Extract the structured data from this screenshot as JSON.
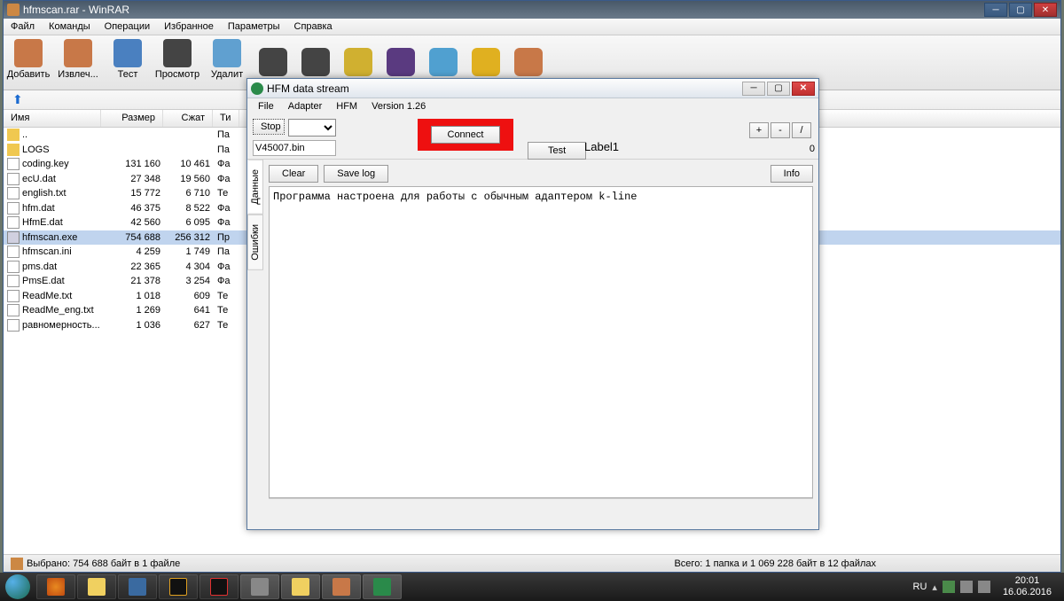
{
  "winrar": {
    "title": "hfmscan.rar - WinRAR",
    "menu": [
      "Файл",
      "Команды",
      "Операции",
      "Избранное",
      "Параметры",
      "Справка"
    ],
    "toolbar": [
      {
        "label": "Добавить",
        "color": "#c87848"
      },
      {
        "label": "Извлеч...",
        "color": "#c87848"
      },
      {
        "label": "Тест",
        "color": "#4a80c0"
      },
      {
        "label": "Просмотр",
        "color": "#444"
      },
      {
        "label": "Удалит",
        "color": "#60a0d0"
      }
    ],
    "columns": {
      "name": "Имя",
      "size": "Размер",
      "packed": "Сжат",
      "type": "Ти"
    },
    "files": [
      {
        "icon": "folder",
        "name": "..",
        "size": "",
        "packed": "",
        "type": "Па"
      },
      {
        "icon": "folder",
        "name": "LOGS",
        "size": "",
        "packed": "",
        "type": "Па"
      },
      {
        "icon": "file",
        "name": "coding.key",
        "size": "131 160",
        "packed": "10 461",
        "type": "Фа"
      },
      {
        "icon": "file",
        "name": "ecU.dat",
        "size": "27 348",
        "packed": "19 560",
        "type": "Фа"
      },
      {
        "icon": "file",
        "name": "english.txt",
        "size": "15 772",
        "packed": "6 710",
        "type": "Те"
      },
      {
        "icon": "file",
        "name": "hfm.dat",
        "size": "46 375",
        "packed": "8 522",
        "type": "Фа"
      },
      {
        "icon": "file",
        "name": "HfmE.dat",
        "size": "42 560",
        "packed": "6 095",
        "type": "Фа"
      },
      {
        "icon": "exe",
        "name": "hfmscan.exe",
        "size": "754 688",
        "packed": "256 312",
        "type": "Пр",
        "selected": true
      },
      {
        "icon": "file",
        "name": "hfmscan.ini",
        "size": "4 259",
        "packed": "1 749",
        "type": "Па"
      },
      {
        "icon": "file",
        "name": "pms.dat",
        "size": "22 365",
        "packed": "4 304",
        "type": "Фа"
      },
      {
        "icon": "file",
        "name": "PmsE.dat",
        "size": "21 378",
        "packed": "3 254",
        "type": "Фа"
      },
      {
        "icon": "file",
        "name": "ReadMe.txt",
        "size": "1 018",
        "packed": "609",
        "type": "Те"
      },
      {
        "icon": "file",
        "name": "ReadMe_eng.txt",
        "size": "1 269",
        "packed": "641",
        "type": "Те"
      },
      {
        "icon": "file",
        "name": "равномерность...",
        "size": "1 036",
        "packed": "627",
        "type": "Те"
      }
    ],
    "status_left": "Выбрано: 754 688 байт в 1 файле",
    "status_right": "Всего: 1 папка и 1 069 228 байт в 12 файлах"
  },
  "hfm": {
    "title": "HFM data stream",
    "menu": [
      "File",
      "Adapter",
      "HFM",
      "Version 1.26"
    ],
    "stop_btn": "Stop",
    "file_input": "V45007.bin",
    "connect_btn": "Connect",
    "test_btn": "Test",
    "label1": "Label1",
    "zero": "0",
    "btn_plus": "+",
    "btn_minus": "-",
    "btn_slash": "/",
    "tabs": {
      "data": "Данные",
      "errors": "Ошибки"
    },
    "clear_btn": "Clear",
    "savelog_btn": "Save log",
    "info_btn": "Info",
    "log_text": "Программа настроена для работы с обычным адаптером k-line"
  },
  "taskbar": {
    "lang": "RU",
    "time": "20:01",
    "date": "16.06.2016"
  }
}
